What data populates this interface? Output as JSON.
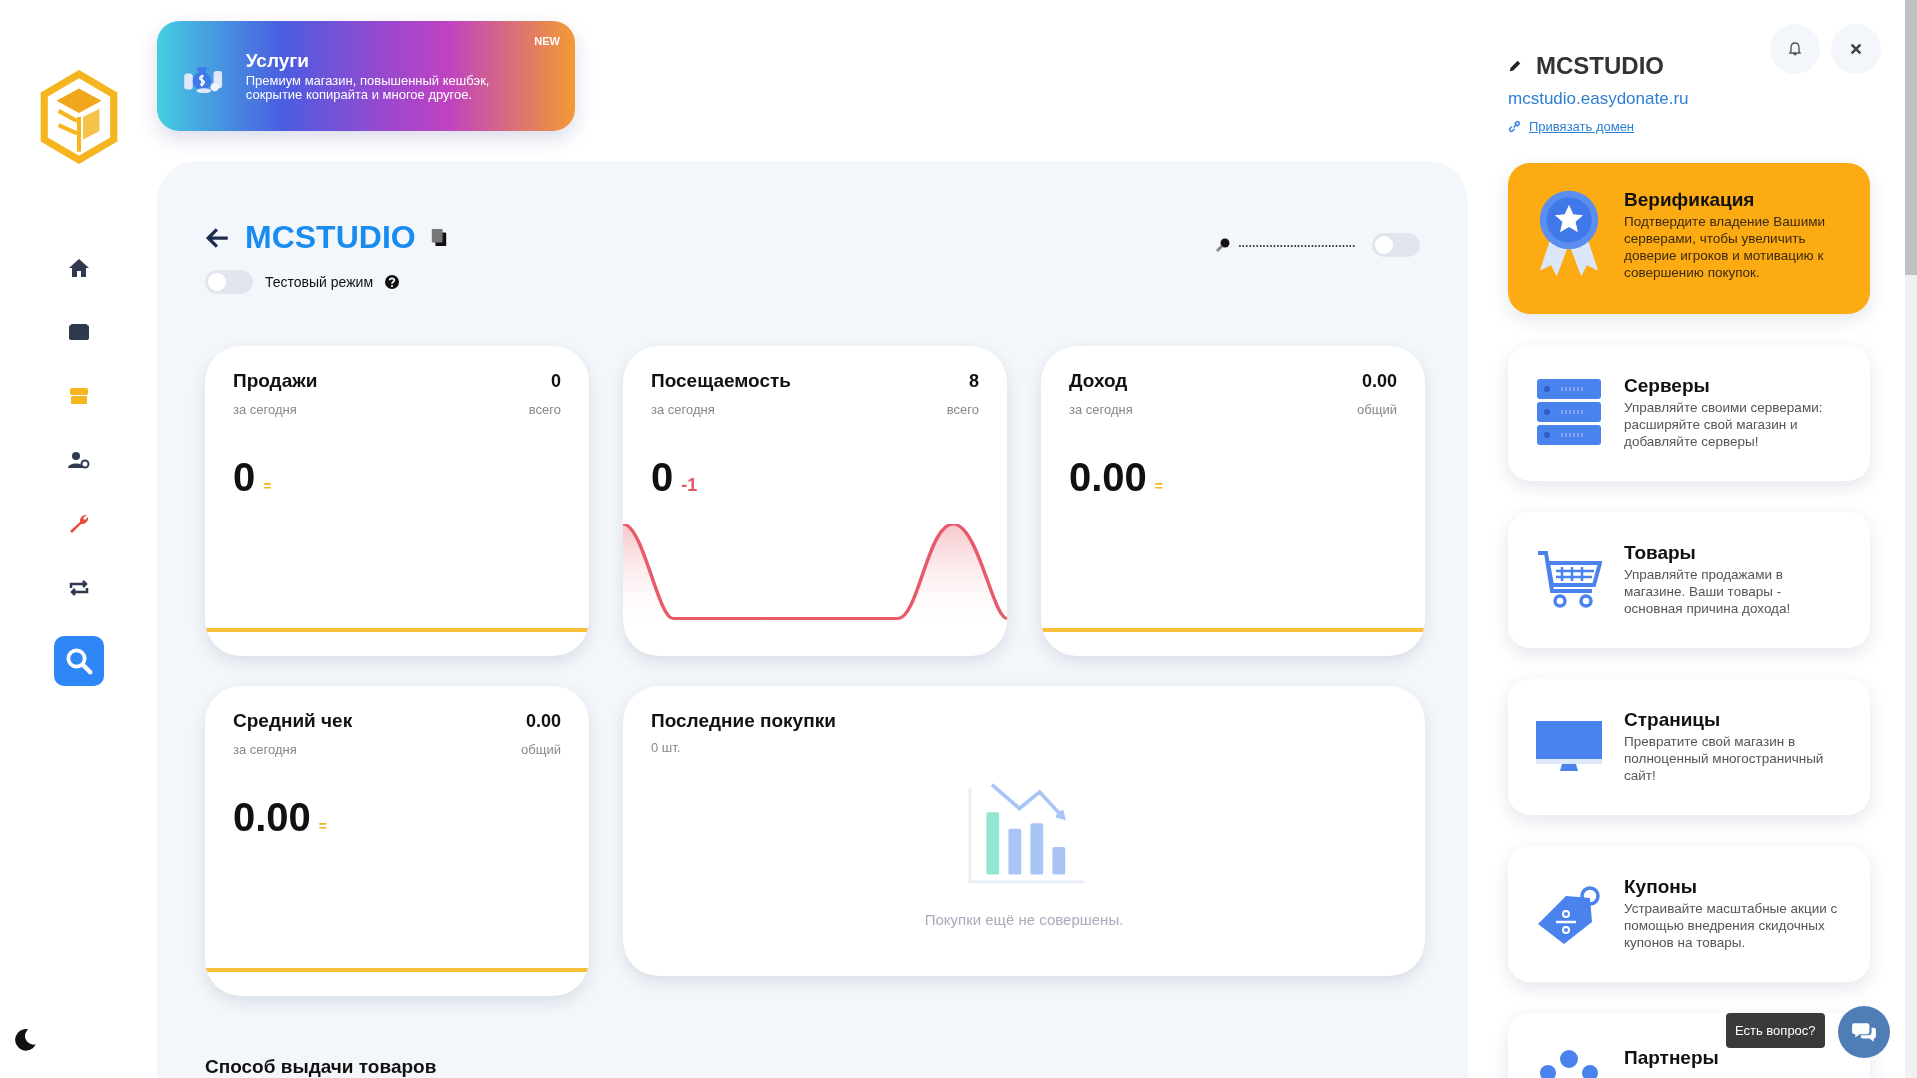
{
  "sidebar": {
    "items": [
      {
        "selected": false
      },
      {
        "selected": false
      },
      {
        "selected": true
      },
      {
        "selected": false
      },
      {
        "selected": false
      },
      {
        "selected": false
      },
      {
        "selected": false
      }
    ]
  },
  "promo": {
    "title": "Услуги",
    "text": "Премиум магазин, повышенный кешбэк, сокрытие копирайта и многое другое.",
    "badge": "NEW"
  },
  "header": {
    "title": "MCSTUDIO",
    "key_mask": "••••••••••••••••••••••••••••••••••",
    "key_toggle": {
      "on": false
    },
    "test_mode": {
      "label": "Тестовый режим",
      "on": false
    }
  },
  "stats": [
    {
      "title": "Продажи",
      "total": "0",
      "total_label": "всего",
      "period": "за сегодня",
      "value": "0",
      "delta": "=",
      "kind": "flat"
    },
    {
      "title": "Посещаемость",
      "total": "8",
      "total_label": "всего",
      "period": "за сегодня",
      "value": "0",
      "delta": "-1",
      "kind": "wave"
    },
    {
      "title": "Доход",
      "total": "0.00",
      "total_label": "общий",
      "period": "за сегодня",
      "value": "0.00",
      "delta": "=",
      "kind": "flat"
    },
    {
      "title": "Средний чек",
      "total": "0.00",
      "total_label": "общий",
      "period": "за сегодня",
      "value": "0.00",
      "delta": "=",
      "kind": "flat"
    }
  ],
  "purchases": {
    "title": "Последние покупки",
    "count": "0 шт.",
    "empty": "Покупки ещё не совершены."
  },
  "delivery": {
    "title": "Способ выдачи товаров"
  },
  "project": {
    "name": "MCSTUDIO",
    "url": "mcstudio.easydonate.ru",
    "link": "Привязать домен"
  },
  "cards": [
    {
      "kind": "verify",
      "title": "Верификация",
      "text": "Подтвердите владение Вашими серверами, чтобы увеличить доверие игроков и мотивацию к совершению покупок."
    },
    {
      "kind": "servers",
      "title": "Серверы",
      "text": "Управляйте своими серверами: расширяйте свой магазин и добавляйте серверы!"
    },
    {
      "kind": "products",
      "title": "Товары",
      "text": "Управляйте продажами в магазине. Ваши товары - основная причина дохода!"
    },
    {
      "kind": "pages",
      "title": "Страницы",
      "text": "Превратите свой магазин в полноценный многостраничный сайт!"
    },
    {
      "kind": "coupons",
      "title": "Купоны",
      "text": "Устраивайте масштабные акции с помощью внедрения скидочных купонов на товары."
    },
    {
      "kind": "partners",
      "title": "Партнеры"
    }
  ],
  "chat": {
    "tooltip": "Есть вопрос?"
  }
}
